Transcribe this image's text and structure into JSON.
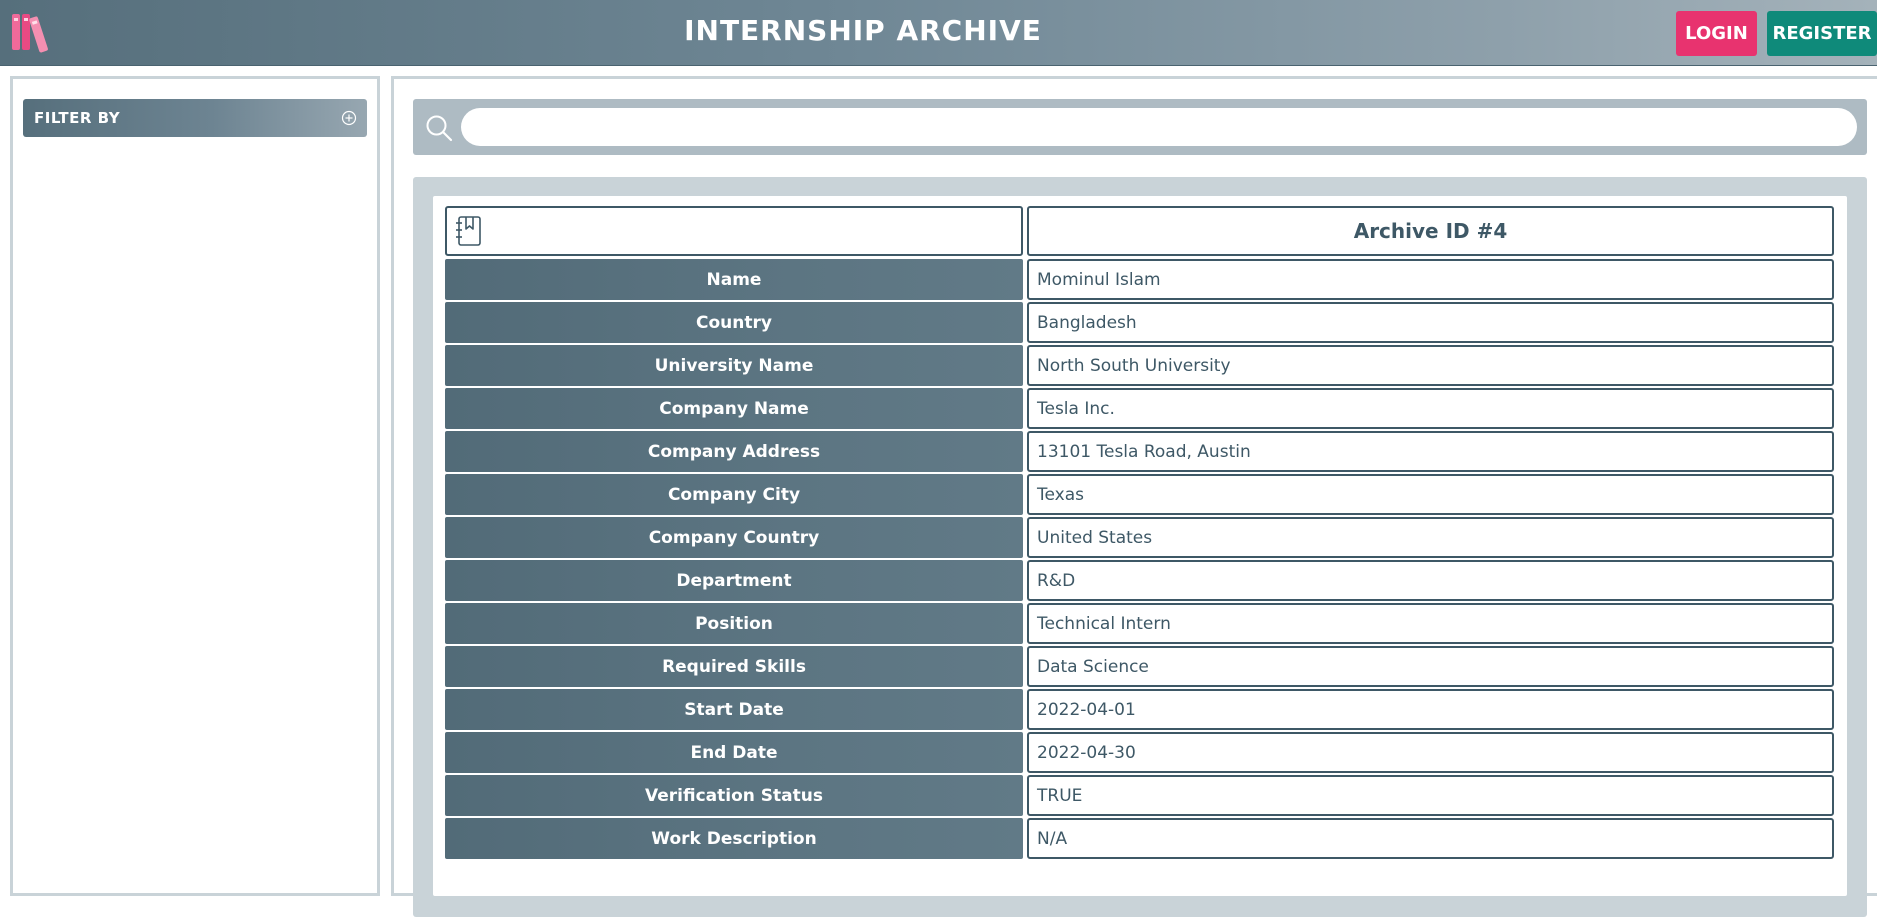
{
  "header": {
    "title": "INTERNSHIP ARCHIVE",
    "logo_icon": "books-icon",
    "login_label": "LOGIN",
    "register_label": "REGISTER",
    "colors": {
      "login": "#e8336f",
      "register": "#0f8a7a"
    }
  },
  "sidebar": {
    "filter_label": "FILTER BY",
    "filter_icon": "plus-circle-icon"
  },
  "search": {
    "placeholder": "",
    "value": "",
    "icon": "search-icon"
  },
  "record": {
    "header_icon": "bookmark-notebook-icon",
    "heading": "Archive ID #4",
    "fields": [
      {
        "label": "Name",
        "value": "Mominul Islam"
      },
      {
        "label": "Country",
        "value": "Bangladesh"
      },
      {
        "label": "University Name",
        "value": "North South University"
      },
      {
        "label": "Company Name",
        "value": "Tesla Inc."
      },
      {
        "label": "Company Address",
        "value": "13101 Tesla Road, Austin"
      },
      {
        "label": "Company City",
        "value": "Texas"
      },
      {
        "label": "Company Country",
        "value": "United States"
      },
      {
        "label": "Department",
        "value": "R&D"
      },
      {
        "label": "Position",
        "value": "Technical Intern"
      },
      {
        "label": "Required Skills",
        "value": "Data Science"
      },
      {
        "label": "Start Date",
        "value": "2022-04-01"
      },
      {
        "label": "End Date",
        "value": "2022-04-30"
      },
      {
        "label": "Verification Status",
        "value": "TRUE"
      },
      {
        "label": "Work Description",
        "value": "N/A"
      }
    ]
  }
}
